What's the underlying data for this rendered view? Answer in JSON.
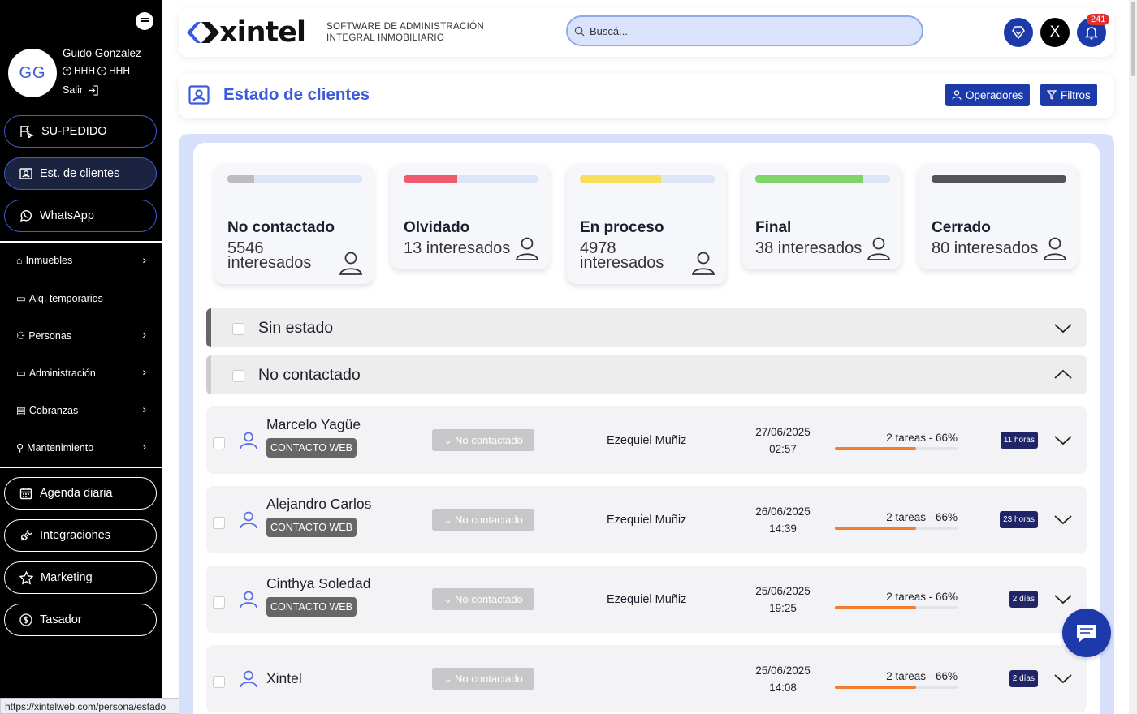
{
  "sidebar": {
    "initials": "GG",
    "user_name": "Guido Gonzalez",
    "meta1": "HHH",
    "meta2": "HHH",
    "logout": "Salir",
    "top_buttons": [
      "SU-PEDIDO",
      "Est. de clientes",
      "WhatsApp"
    ],
    "nav": [
      "Inmuebles",
      "Alq. temporarios",
      "Personas",
      "Administración",
      "Cobranzas",
      "Mantenimiento"
    ],
    "bottom_buttons": [
      "Agenda diaria",
      "Integraciones",
      "Marketing",
      "Tasador"
    ]
  },
  "header": {
    "logo": "xintel",
    "subtitle_line1": "SOFTWARE DE ADMINISTRACIÓN",
    "subtitle_line2": "INTEGRAL INMOBILIARIO",
    "search_placeholder": "Buscá...",
    "x_label": "X",
    "notifications": "241"
  },
  "page": {
    "title": "Estado de clientes",
    "operadores": "Operadores",
    "filtros": "Filtros"
  },
  "status_cards": [
    {
      "title": "No contactado",
      "count": "5546 interesados",
      "progress": 0.2,
      "color": "#bdbdbd"
    },
    {
      "title": "Olvidado",
      "count": "13 interesados",
      "progress": 0.4,
      "color": "#ef5a6f"
    },
    {
      "title": "En proceso",
      "count": "4978 interesados",
      "progress": 0.6,
      "color": "#f7df5e"
    },
    {
      "title": "Final",
      "count": "38 interesados",
      "progress": 0.8,
      "color": "#7fd46a"
    },
    {
      "title": "Cerrado",
      "count": "80 interesados",
      "progress": 1.0,
      "color": "#555555"
    }
  ],
  "sections": [
    {
      "title": "Sin estado",
      "expanded": false
    },
    {
      "title": "No contactado",
      "expanded": true
    }
  ],
  "clients": [
    {
      "name": "Marcelo Yagüe",
      "tag": "CONTACTO WEB",
      "status": "No contactado",
      "operator": "Ezequiel Muñiz",
      "date": "27/06/2025",
      "time": "02:57",
      "tasks": "2 tareas - 66%",
      "progress": 0.66,
      "elapsed": "11 horas"
    },
    {
      "name": "Alejandro Carlos",
      "tag": "CONTACTO WEB",
      "status": "No contactado",
      "operator": "Ezequiel Muñiz",
      "date": "26/06/2025",
      "time": "14:39",
      "tasks": "2 tareas - 66%",
      "progress": 0.66,
      "elapsed": "23 horas"
    },
    {
      "name": "Cinthya Soledad",
      "tag": "CONTACTO WEB",
      "status": "No contactado",
      "operator": "Ezequiel Muñiz",
      "date": "25/06/2025",
      "time": "19:25",
      "tasks": "2 tareas - 66%",
      "progress": 0.66,
      "elapsed": "2 días"
    },
    {
      "name": "Xintel",
      "tag": "",
      "status": "No contactado",
      "operator": "",
      "date": "25/06/2025",
      "time": "14:08",
      "tasks": "2 tareas - 66%",
      "progress": 0.66,
      "elapsed": "2 días"
    }
  ],
  "status_url": "https://xintelweb.com/persona/estado"
}
